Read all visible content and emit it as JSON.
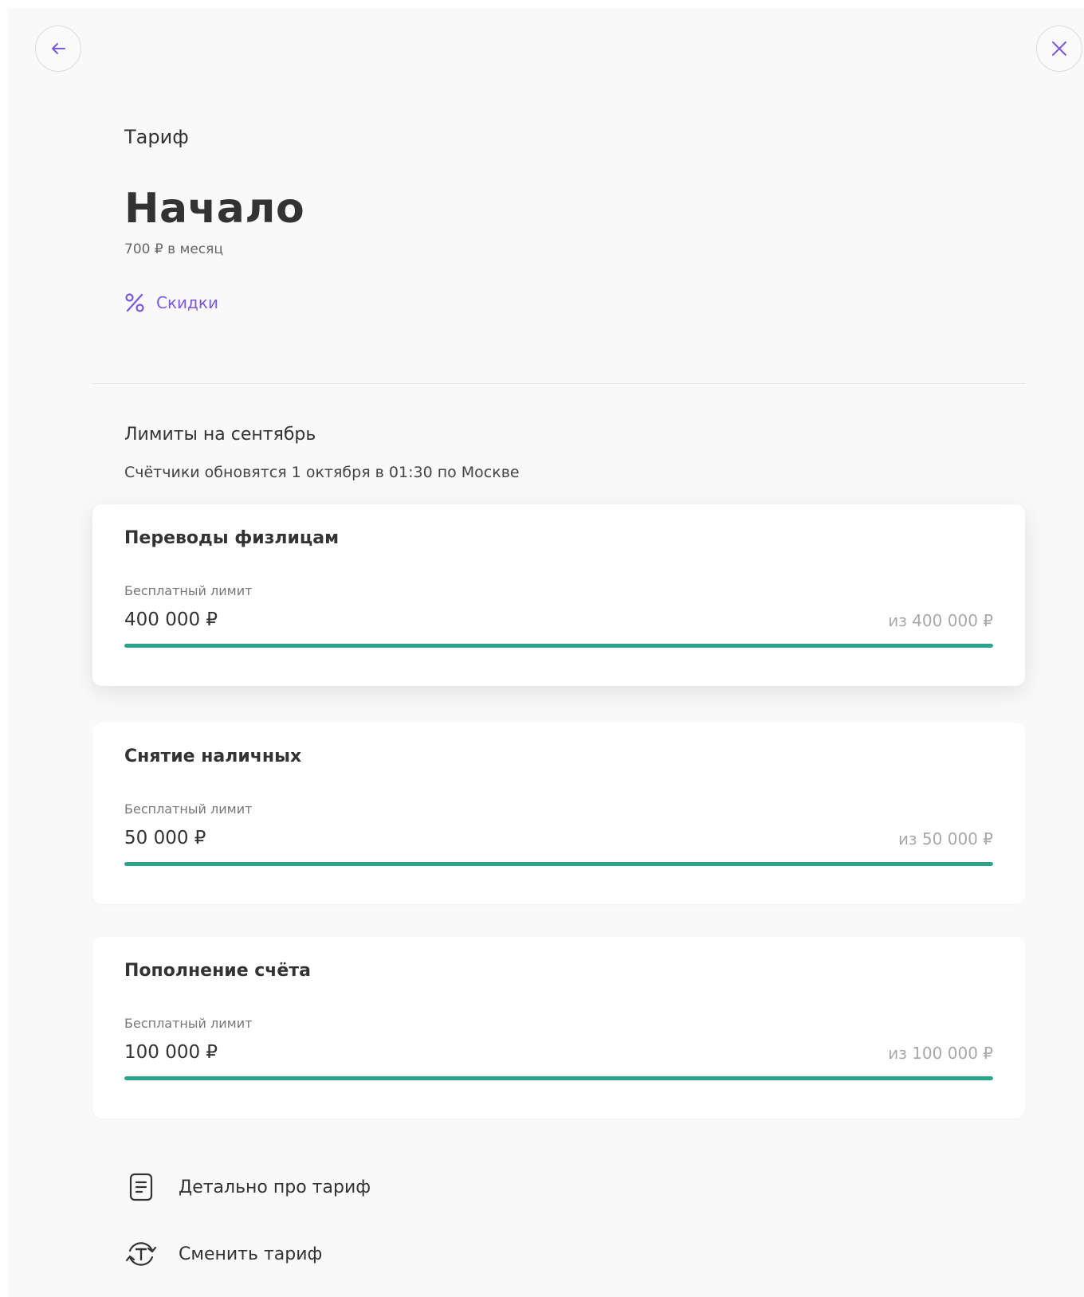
{
  "header": {
    "back_icon": "arrow-left-icon",
    "close_icon": "close-icon",
    "icon_color": "#7b57e0"
  },
  "tariff": {
    "label": "Тариф",
    "name": "Начало",
    "price": "700 ₽ в месяц",
    "discounts_label": "Скидки",
    "discounts_icon": "percent-icon"
  },
  "limits": {
    "title": "Лимиты на сентябрь",
    "subtitle": "Счётчики обновятся 1 октября в 01:30 по Москве",
    "progress_color": "#2aa58c",
    "cards": [
      {
        "title": "Переводы физлицам",
        "sublabel": "Бесплатный лимит",
        "amount": "400 000 ₽",
        "total": "из 400 000 ₽",
        "progress_fraction": 1.0
      },
      {
        "title": "Снятие наличных",
        "sublabel": "Бесплатный лимит",
        "amount": "50 000 ₽",
        "total": "из 50 000 ₽",
        "progress_fraction": 1.0
      },
      {
        "title": "Пополнение счёта",
        "sublabel": "Бесплатный лимит",
        "amount": "100 000 ₽",
        "total": "из 100 000 ₽",
        "progress_fraction": 1.0
      }
    ]
  },
  "actions": [
    {
      "label": "Детально про тариф",
      "icon": "document-icon"
    },
    {
      "label": "Сменить тариф",
      "icon": "change-tariff-icon"
    }
  ]
}
